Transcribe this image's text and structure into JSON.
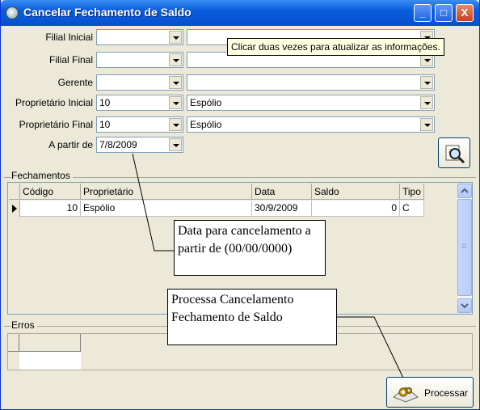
{
  "window": {
    "title": "Cancelar Fechamento de Saldo",
    "min_glyph": "_",
    "max_glyph": "□",
    "close_glyph": "X"
  },
  "filters": {
    "filial_inicial": {
      "label": "Filial Inicial",
      "value": "",
      "desc": ""
    },
    "filial_final": {
      "label": "Filial Final",
      "value": "",
      "desc": ""
    },
    "gerente": {
      "label": "Gerente",
      "value": "",
      "desc": ""
    },
    "proprietario_inicial": {
      "label": "Proprietário Inicial",
      "value": "10",
      "desc": "Espólio"
    },
    "proprietario_final": {
      "label": "Proprietário Final",
      "value": "10",
      "desc": "Espólio"
    },
    "a_partir_de": {
      "label": "A partir de",
      "value": "7/8/2009"
    }
  },
  "tooltip": "Clicar duas vezes para atualizar as informações.",
  "fechamentos": {
    "title": "Fechamentos",
    "columns": [
      "Código",
      "Proprietário",
      "Data",
      "Saldo",
      "Tipo"
    ],
    "rows": [
      {
        "codigo": "10",
        "proprietario": "Espólio",
        "data": "30/9/2009",
        "saldo": "0",
        "tipo": "C"
      }
    ]
  },
  "erros": {
    "title": "Erros"
  },
  "annotations": {
    "date_note": "Data para cancelamento a partir de (00/00/0000)",
    "process_note": "Processa Cancelamento Fechamento de Saldo"
  },
  "buttons": {
    "processar": "Processar"
  },
  "icons": {
    "search": "magnifier-icon",
    "process": "gears-icon"
  }
}
